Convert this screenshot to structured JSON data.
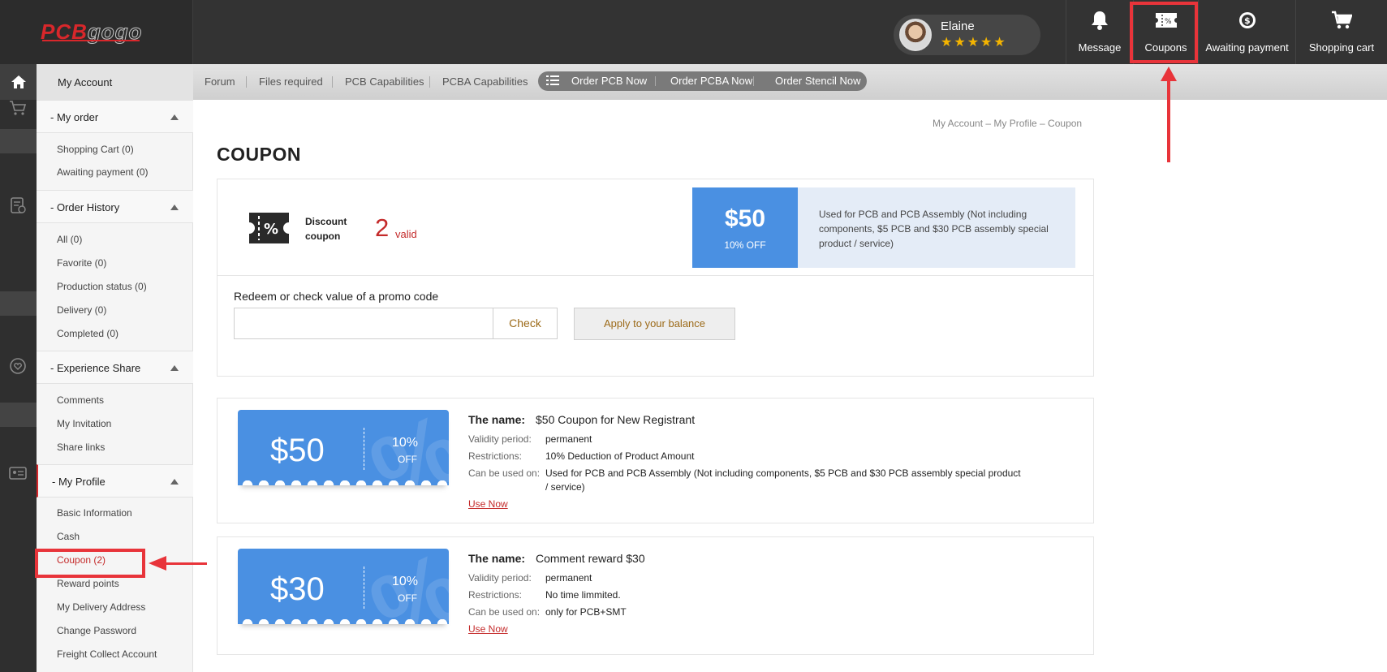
{
  "header": {
    "logo": {
      "part1": "PCB",
      "part2": "gogo"
    },
    "user": {
      "name": "Elaine",
      "stars": "★★★★★"
    },
    "nav": [
      {
        "label": "Message",
        "icon": "bell-icon"
      },
      {
        "label": "Coupons",
        "icon": "coupon-icon"
      },
      {
        "label": "Awaiting payment",
        "icon": "dollar-coin-icon"
      },
      {
        "label": "Shopping cart",
        "icon": "cart-icon"
      }
    ]
  },
  "subnav": {
    "links": [
      "Forum",
      "Files required",
      "PCB Capabilities",
      "PCBA Capabilities"
    ],
    "order_buttons": [
      "Order PCB Now",
      "Order PCBA Now",
      "Order Stencil Now"
    ]
  },
  "sidebar": {
    "title": "My Account",
    "sections": [
      {
        "title": "- My order",
        "items": [
          "Shopping Cart (0)",
          "Awaiting payment (0)"
        ]
      },
      {
        "title": "- Order History",
        "items": [
          "All (0)",
          "Favorite (0)",
          "Production status (0)",
          "Delivery (0)",
          "Completed (0)"
        ]
      },
      {
        "title": "- Experience Share",
        "items": [
          "Comments",
          "My Invitation",
          "Share links"
        ]
      },
      {
        "title": "- My Profile",
        "items": [
          "Basic Information",
          "Cash",
          "Coupon (2)",
          "Reward points",
          "My Delivery Address",
          "Change Password",
          "Freight Collect Account"
        ]
      }
    ]
  },
  "breadcrumb": "My Account  –  My Profile  –  Coupon",
  "page_title": "COUPON",
  "summary": {
    "label_line1": "Discount",
    "label_line2": "coupon",
    "count": "2",
    "count_suffix": "valid",
    "featured": {
      "amount": "$50",
      "off": "10% OFF",
      "description": "Used for PCB and PCB Assembly (Not including components, $5 PCB and $30 PCB assembly special product / service)"
    }
  },
  "promo": {
    "label": "Redeem or check value of a promo code",
    "placeholder": "",
    "check_label": "Check",
    "apply_label": "Apply to your balance"
  },
  "coupons": [
    {
      "amount": "$50",
      "percent": "10%",
      "off": "OFF",
      "name_label": "The name:",
      "name": "$50 Coupon for New Registrant",
      "validity_label": "Validity period:",
      "validity": "permanent",
      "restrictions_label": "Restrictions:",
      "restrictions": "10% Deduction of Product Amount",
      "usage_label": "Can be used on:",
      "usage_line1": "Used for PCB and PCB Assembly (Not including components, $5 PCB and $30 PCB assembly special product",
      "usage_line2": "/ service)",
      "use_now": "Use Now"
    },
    {
      "amount": "$30",
      "percent": "10%",
      "off": "OFF",
      "name_label": "The name:",
      "name": "Comment reward $30",
      "validity_label": "Validity period:",
      "validity": "permanent",
      "restrictions_label": "Restrictions:",
      "restrictions": "No time limmited.",
      "usage_label": "Can be used on:",
      "usage_line1": "only for PCB+SMT",
      "use_now": "Use Now"
    }
  ],
  "colors": {
    "accent_blue": "#4a90e2",
    "brand_red": "#d8272b",
    "highlight_red": "#e8343a"
  }
}
